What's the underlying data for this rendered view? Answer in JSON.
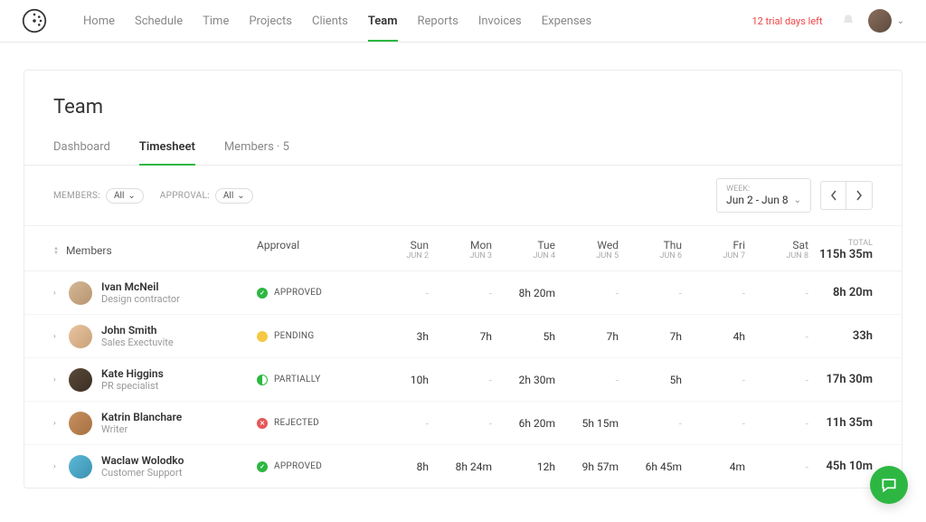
{
  "nav": {
    "items": [
      "Home",
      "Schedule",
      "Time",
      "Projects",
      "Clients",
      "Team",
      "Reports",
      "Invoices",
      "Expenses"
    ],
    "active_index": 5,
    "trial": "12 trial days left"
  },
  "page": {
    "title": "Team"
  },
  "tabs": {
    "dashboard": "Dashboard",
    "timesheet": "Timesheet",
    "members": "Members · 5",
    "active": "timesheet"
  },
  "filters": {
    "members_label": "MEMBERS:",
    "members_value": "All",
    "approval_label": "APPROVAL:",
    "approval_value": "All"
  },
  "week": {
    "label": "WEEK:",
    "range": "Jun 2 - Jun 8"
  },
  "table": {
    "headers": {
      "members": "Members",
      "approval": "Approval",
      "days": [
        {
          "name": "Sun",
          "date": "JUN 2"
        },
        {
          "name": "Mon",
          "date": "JUN 3"
        },
        {
          "name": "Tue",
          "date": "JUN 4"
        },
        {
          "name": "Wed",
          "date": "JUN 5"
        },
        {
          "name": "Thu",
          "date": "JUN 6"
        },
        {
          "name": "Fri",
          "date": "JUN 7"
        },
        {
          "name": "Sat",
          "date": "JUN 8"
        }
      ],
      "total_label": "TOTAL",
      "total_value": "115h 35m"
    },
    "rows": [
      {
        "name": "Ivan McNeil",
        "role": "Design contractor",
        "approval": "APPROVED",
        "days": [
          "-",
          "-",
          "8h 20m",
          "-",
          "-",
          "-",
          "-"
        ],
        "total": "8h 20m",
        "avatar_class": "av1"
      },
      {
        "name": "John Smith",
        "role": "Sales Exectuvite",
        "approval": "PENDING",
        "days": [
          "3h",
          "7h",
          "5h",
          "7h",
          "7h",
          "4h",
          "-"
        ],
        "total": "33h",
        "avatar_class": "av2"
      },
      {
        "name": "Kate Higgins",
        "role": "PR specialist",
        "approval": "PARTIALLY",
        "days": [
          "10h",
          "-",
          "2h 30m",
          "-",
          "5h",
          "-",
          "-"
        ],
        "total": "17h 30m",
        "avatar_class": "av3"
      },
      {
        "name": "Katrin Blanchare",
        "role": "Writer",
        "approval": "REJECTED",
        "days": [
          "-",
          "-",
          "6h 20m",
          "5h 15m",
          "-",
          "-",
          "-"
        ],
        "total": "11h 35m",
        "avatar_class": "av4"
      },
      {
        "name": "Waclaw Wolodko",
        "role": "Customer Support",
        "approval": "APPROVED",
        "days": [
          "8h",
          "8h 24m",
          "12h",
          "9h 57m",
          "6h 45m",
          "4m",
          "-"
        ],
        "total": "45h 10m",
        "avatar_class": "av5"
      }
    ]
  }
}
